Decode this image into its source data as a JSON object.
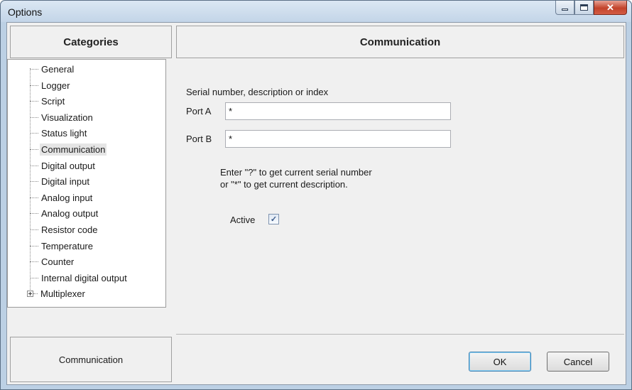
{
  "window": {
    "title": "Options",
    "controls": {
      "minimize": "minimize",
      "maximize": "maximize",
      "close": "close"
    }
  },
  "categories": {
    "header": "Categories",
    "items": [
      {
        "label": "General",
        "selected": false,
        "expandable": false
      },
      {
        "label": "Logger",
        "selected": false,
        "expandable": false
      },
      {
        "label": "Script",
        "selected": false,
        "expandable": false
      },
      {
        "label": "Visualization",
        "selected": false,
        "expandable": false
      },
      {
        "label": "Status light",
        "selected": false,
        "expandable": false
      },
      {
        "label": "Communication",
        "selected": true,
        "expandable": false
      },
      {
        "label": "Digital output",
        "selected": false,
        "expandable": false
      },
      {
        "label": "Digital input",
        "selected": false,
        "expandable": false
      },
      {
        "label": "Analog input",
        "selected": false,
        "expandable": false
      },
      {
        "label": "Analog output",
        "selected": false,
        "expandable": false
      },
      {
        "label": "Resistor code",
        "selected": false,
        "expandable": false
      },
      {
        "label": "Temperature",
        "selected": false,
        "expandable": false
      },
      {
        "label": "Counter",
        "selected": false,
        "expandable": false
      },
      {
        "label": "Internal digital output",
        "selected": false,
        "expandable": false
      },
      {
        "label": "Multiplexer",
        "selected": false,
        "expandable": true
      }
    ],
    "footer": "Communication"
  },
  "panel": {
    "header": "Communication",
    "section_label": "Serial number, description or index",
    "port_a": {
      "label": "Port A",
      "value": "*"
    },
    "port_b": {
      "label": "Port B",
      "value": "*"
    },
    "hint_line1": "Enter \"?\" to get current serial number",
    "hint_line2": "or \"*\" to get current description.",
    "active": {
      "label": "Active",
      "checked": true
    }
  },
  "buttons": {
    "ok": "OK",
    "cancel": "Cancel"
  }
}
